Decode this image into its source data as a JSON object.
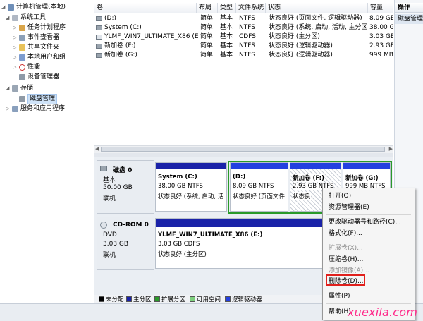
{
  "tree": {
    "root": "计算机管理(本地)",
    "system_tools": "系统工具",
    "task_scheduler": "任务计划程序",
    "event_viewer": "事件查看器",
    "shared_folders": "共享文件夹",
    "local_users": "本地用户和组",
    "performance": "性能",
    "device_manager": "设备管理器",
    "storage": "存储",
    "disk_mgmt": "磁盘管理",
    "services_apps": "服务和应用程序"
  },
  "list": {
    "columns": [
      "卷",
      "布局",
      "类型",
      "文件系统",
      "状态",
      "容量"
    ],
    "rows": [
      [
        "(D:)",
        "简单",
        "基本",
        "NTFS",
        "状态良好 (页面文件, 逻辑驱动器)",
        "8.09 GB"
      ],
      [
        "System (C:)",
        "简单",
        "基本",
        "NTFS",
        "状态良好 (系统, 启动, 活动, 主分区)",
        "38.00 GB"
      ],
      [
        "YLMF_WIN7_ULTIMATE_X86 (E:)",
        "简单",
        "基本",
        "CDFS",
        "状态良好 (主分区)",
        "3.03 GB"
      ],
      [
        "新加卷 (F:)",
        "简单",
        "基本",
        "NTFS",
        "状态良好 (逻辑驱动器)",
        "2.93 GB"
      ],
      [
        "新加卷 (G:)",
        "简单",
        "基本",
        "NTFS",
        "状态良好 (逻辑驱动器)",
        "999 MB"
      ]
    ]
  },
  "actions": {
    "title": "操作",
    "item": "磁盘管理"
  },
  "disk0": {
    "name": "磁盘 0",
    "type": "基本",
    "size": "50.00 GB",
    "state": "联机",
    "partitions": [
      {
        "title": "System  (C:)",
        "size": "38.00 GB NTFS",
        "status": "状态良好 (系统, 启动, 活",
        "bar": "#1a22a8"
      },
      {
        "title": "(D:)",
        "size": "8.09 GB NTFS",
        "status": "状态良好 (页面文件",
        "bar": "#1a22a8"
      },
      {
        "title": "新加卷 (F:)",
        "size": "2.93 GB NTFS",
        "status": "状态良",
        "bar": "#1a22a8"
      },
      {
        "title": "新加卷 (G:)",
        "size": "999 MB NTFS",
        "status": "",
        "bar": "#1a22a8"
      }
    ]
  },
  "cdrom0": {
    "name": "CD-ROM 0",
    "type": "DVD",
    "size": "3.03 GB",
    "state": "联机",
    "partition": {
      "title": "YLMF_WIN7_ULTIMATE_X86  (E:)",
      "size": "3.03 GB CDFS",
      "status": "状态良好 (主分区)",
      "bar": "#1a22a8"
    }
  },
  "legend": [
    {
      "label": "未分配",
      "color": "#000000"
    },
    {
      "label": "主分区",
      "color": "#1a22a8"
    },
    {
      "label": "扩展分区",
      "color": "#2a9a2a"
    },
    {
      "label": "可用空间",
      "color": "#7ed07e"
    },
    {
      "label": "逻辑驱动器",
      "color": "#2440e0"
    }
  ],
  "menu": {
    "open": "打开(O)",
    "explore": "资源管理器(E)",
    "change_letter": "更改驱动器号和路径(C)...",
    "format": "格式化(F)...",
    "extend": "扩展卷(X)...",
    "shrink": "压缩卷(H)...",
    "mirror": "添加镜像(A)...",
    "delete": "删除卷(D)...",
    "properties": "属性(P)",
    "help": "帮助(H)"
  },
  "watermark": "xuexila.com",
  "colors": {
    "primary": "#1a22a8",
    "extended": "#2a9a2a",
    "highlight": "#e0201c"
  }
}
